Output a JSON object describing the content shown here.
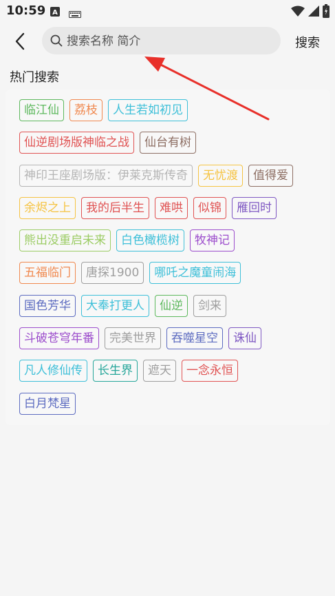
{
  "status_bar": {
    "time": "10:59"
  },
  "header": {
    "search_placeholder": "搜索名称 简介",
    "search_button": "搜索"
  },
  "hot_search": {
    "title": "热门搜索",
    "rows": [
      [
        {
          "label": "临江仙",
          "color": "#5cb85c"
        },
        {
          "label": "荔枝",
          "color": "#f0884e"
        },
        {
          "label": "人生若如初见",
          "color": "#3dbfd8"
        }
      ],
      [
        {
          "label": "仙逆剧场版神临之战",
          "color": "#e05252"
        },
        {
          "label": "仙台有树",
          "color": "#8d6e63"
        }
      ],
      [
        {
          "label": "神印王座剧场版：伊莱克斯传奇",
          "color": "#b5b5b5"
        },
        {
          "label": "无忧渡",
          "color": "#f5c342"
        },
        {
          "label": "值得爱",
          "color": "#8d6e63"
        }
      ],
      [
        {
          "label": "余烬之上",
          "color": "#f5c342"
        },
        {
          "label": "我的后半生",
          "color": "#e05252"
        },
        {
          "label": "难哄",
          "color": "#e05252"
        },
        {
          "label": "似锦",
          "color": "#e05252"
        },
        {
          "label": "雁回时",
          "color": "#7e57c2"
        }
      ],
      [
        {
          "label": "熊出没重启未来",
          "color": "#9ccc65"
        },
        {
          "label": "白色橄榄树",
          "color": "#3dbfd8"
        },
        {
          "label": "牧神记",
          "color": "#9c4dcc"
        }
      ],
      [
        {
          "label": "五福临门",
          "color": "#f0884e"
        },
        {
          "label": "唐探1900",
          "color": "#9e9e9e"
        },
        {
          "label": "哪吒之魔童闹海",
          "color": "#3dbfd8"
        }
      ],
      [
        {
          "label": "国色芳华",
          "color": "#5c6bc0"
        },
        {
          "label": "大奉打更人",
          "color": "#3dbfd8"
        },
        {
          "label": "仙逆",
          "color": "#5cb85c"
        },
        {
          "label": "剑来",
          "color": "#9e9e9e"
        }
      ],
      [
        {
          "label": "斗破苍穹年番",
          "color": "#9c4dcc"
        },
        {
          "label": "完美世界",
          "color": "#9e9e9e"
        },
        {
          "label": "吞噬星空",
          "color": "#5c6bc0"
        },
        {
          "label": "诛仙",
          "color": "#7e57c2"
        }
      ],
      [
        {
          "label": "凡人修仙传",
          "color": "#3dbfd8"
        },
        {
          "label": "长生界",
          "color": "#26a69a"
        },
        {
          "label": "遮天",
          "color": "#9e9e9e"
        },
        {
          "label": "一念永恒",
          "color": "#e05252"
        }
      ],
      [
        {
          "label": "白月梵星",
          "color": "#5c6bc0"
        }
      ]
    ]
  },
  "annotation": {
    "arrow_color": "#e8302a"
  }
}
